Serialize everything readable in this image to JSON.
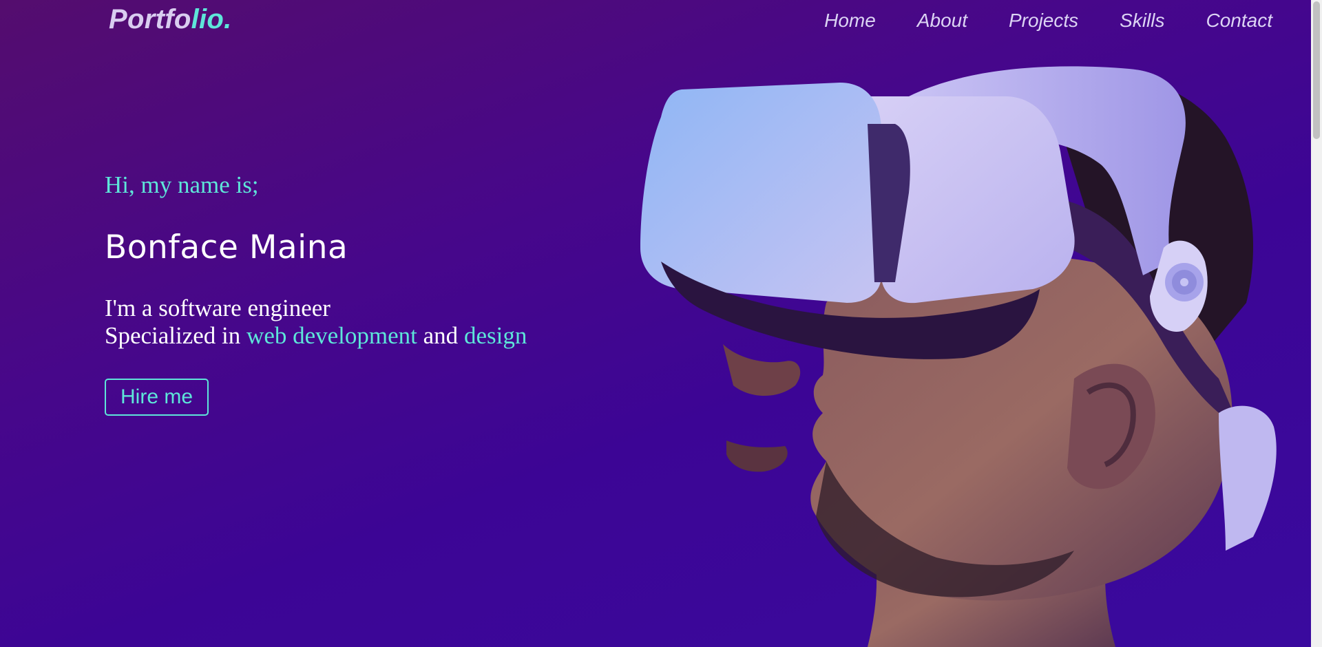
{
  "logo": {
    "part1": "Portfo",
    "part2": "lio."
  },
  "nav": {
    "items": [
      {
        "label": "Home"
      },
      {
        "label": "About"
      },
      {
        "label": "Projects"
      },
      {
        "label": "Skills"
      },
      {
        "label": "Contact"
      }
    ]
  },
  "hero": {
    "greeting": "Hi, my name is;",
    "name": "Bonface Maina",
    "line1": "I'm a software engineer",
    "line2_prefix": "Specialized in ",
    "line2_highlight1": "web development",
    "line2_mid": " and ",
    "line2_highlight2": "design",
    "cta_label": "Hire me"
  },
  "colors": {
    "accent": "#5ee6d9",
    "background_top": "#540d6e",
    "background_bottom": "#3a0a9e"
  },
  "image": {
    "subject": "person-wearing-vr-headset"
  }
}
